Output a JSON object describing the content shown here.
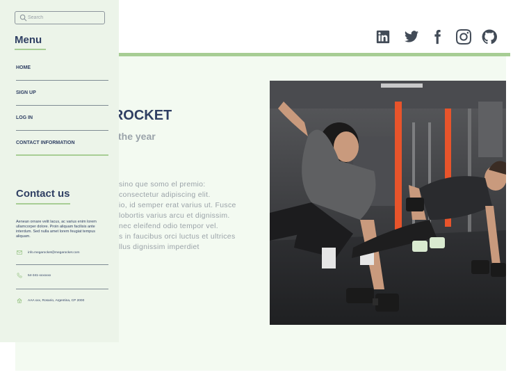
{
  "header": {
    "social": [
      {
        "name": "linkedin"
      },
      {
        "name": "twitter"
      },
      {
        "name": "facebook"
      },
      {
        "name": "instagram"
      },
      {
        "name": "github"
      }
    ]
  },
  "hero": {
    "title": "GA ROCKET",
    "subtitle": "um of the year",
    "text_lines": [
      "sino que somo el premio:",
      "consectetur adipiscing elit.",
      "io, id semper erat varius ut. Fusce",
      "lobortis varius arcu et dignissim.",
      "nec eleifend odio tempor vel.",
      "s in faucibus orci luctus et ultrices",
      "llus dignissim imperdiet"
    ]
  },
  "sidebar": {
    "search": {
      "placeholder": "Search",
      "value": ""
    },
    "menu_title": "Menu",
    "items": [
      {
        "label": "HOME"
      },
      {
        "label": "SIGN UP"
      },
      {
        "label": "LOG IN"
      },
      {
        "label": "CONTACT INFORMATION"
      }
    ],
    "contact": {
      "title": "Contact us",
      "description": "Aenean ornare velit lacus, ac varius enim lorem ullamcorper dolore. Proin aliquam facilisis ante interdum. Sed nulla amet lorem feugiat tempus aliquam.",
      "email": "info.megarocket@megarocket.com",
      "phone": "54-341-xxxxxxx",
      "address": "AAA xxx, Rosario, Argentina, CP 2000"
    }
  },
  "colors": {
    "accent_green": "#a7cd94",
    "sidebar_bg": "#ecf4e9",
    "main_bg": "#f3faf1",
    "heading": "#2f3f63"
  }
}
